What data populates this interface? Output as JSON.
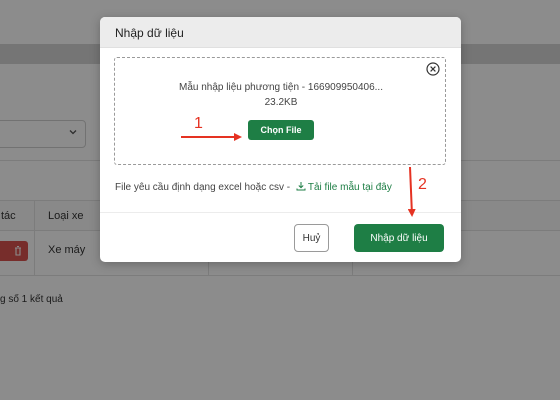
{
  "background": {
    "table": {
      "columns": [
        "tác",
        "Loại xe"
      ],
      "rows": [
        {
          "vehicle_type": "Xe máy"
        }
      ]
    },
    "footer_text": "g số 1 kết quả"
  },
  "modal": {
    "title": "Nhập dữ liệu",
    "file_name": "Mẫu nhập liệu phương tiện - 166909950406...",
    "file_size": "23.2KB",
    "choose_file_label": "Chọn File",
    "hint_text": "File yêu cầu định dạng excel hoặc csv -",
    "download_link_label": "Tải file mẫu tại đây",
    "cancel_label": "Huỷ",
    "submit_label": "Nhập dữ liệu"
  },
  "annotations": [
    {
      "number": "1"
    },
    {
      "number": "2"
    }
  ],
  "colors": {
    "primary_green": "#1e7e45",
    "annotation_red": "#e53222",
    "danger_red": "#d9534f"
  },
  "icons": [
    "close-circle-icon",
    "download-icon",
    "chevron-down-icon",
    "edit-icon",
    "trash-icon"
  ]
}
